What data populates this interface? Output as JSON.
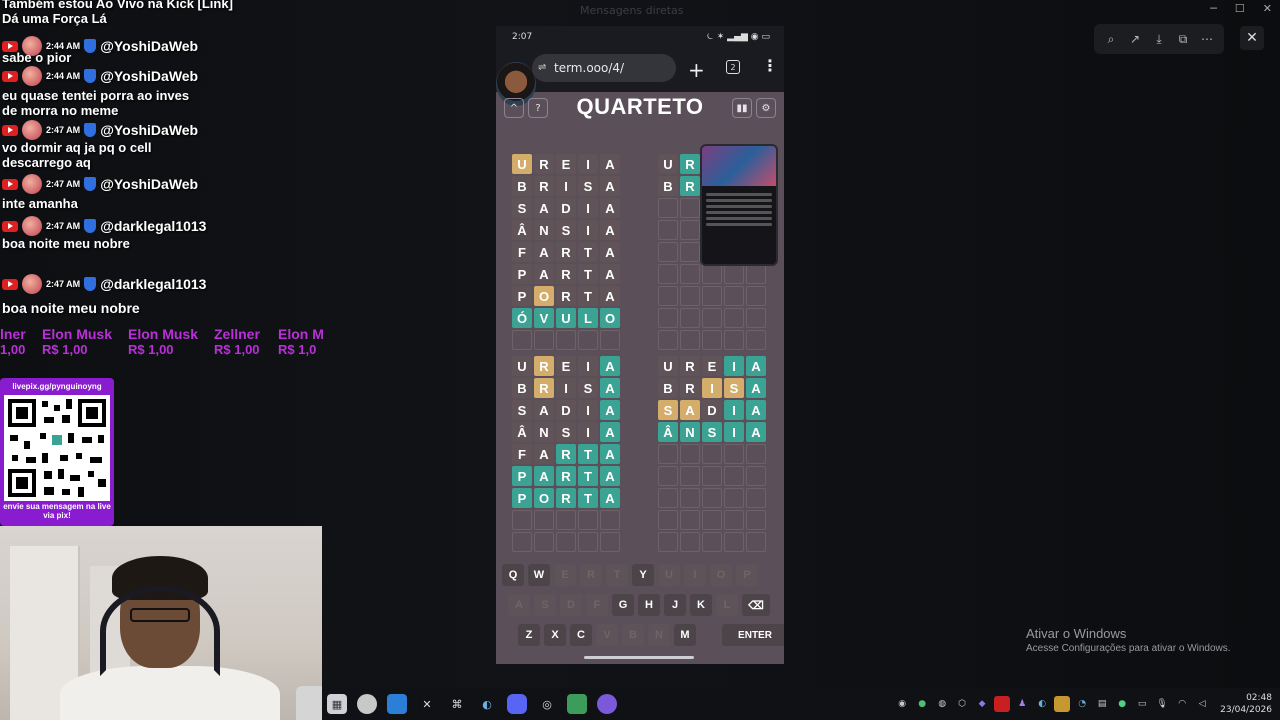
{
  "chat": {
    "messages": [
      {
        "user": "@YoshiDaWeb",
        "time": "2:44 AM",
        "text": "Também estou Ao Vivo na Kick [Link]",
        "text2": "Dá uma Força Lá"
      },
      {
        "user": "@YoshiDaWeb",
        "time": "2:44 AM",
        "text": "sabe o pior"
      },
      {
        "user": "@YoshiDaWeb",
        "time": "2:44 AM",
        "text": "o pior"
      },
      {
        "user": "@YoshiDaWeb",
        "time": "2:47 AM",
        "text": "eu quase tentei porra ao inves de morra no meme"
      },
      {
        "user": "@YoshiDaWeb",
        "time": "2:47 AM",
        "text": "vo dormir aq ja pq o cell descarrego aq"
      },
      {
        "user": "@YoshiDaWeb",
        "time": "2:47 AM",
        "text": "inte amanha"
      },
      {
        "user": "@darklegal1013",
        "time": "2:47 AM",
        "text": "boa noite meu nobre"
      }
    ]
  },
  "ticker": [
    {
      "name": "lner",
      "value": "1,00"
    },
    {
      "name": "Elon Musk",
      "value": "R$ 1,00"
    },
    {
      "name": "Elon Musk",
      "value": "R$ 1,00"
    },
    {
      "name": "Zellner",
      "value": "R$ 1,00"
    },
    {
      "name": "Elon M",
      "value": "R$ 1,0"
    }
  ],
  "pix": {
    "url": "livepix.gg/pynguinoyng",
    "cta": "envie sua mensagem na live via pix!"
  },
  "phone": {
    "time": "2:07",
    "url": "term.ooo/4/",
    "tabs_count": "2",
    "game_title": "QUARTETO",
    "help_icon": "?",
    "up_icon": "^",
    "boards": [
      {
        "rows": [
          [
            [
              "U",
              "y"
            ],
            [
              "R",
              "e"
            ],
            [
              "E",
              "e"
            ],
            [
              "I",
              "e"
            ],
            [
              "A",
              "e"
            ]
          ],
          [
            [
              "B",
              "e"
            ],
            [
              "R",
              "e"
            ],
            [
              "I",
              "e"
            ],
            [
              "S",
              "e"
            ],
            [
              "A",
              "e"
            ]
          ],
          [
            [
              "S",
              "e"
            ],
            [
              "A",
              "e"
            ],
            [
              "D",
              "e"
            ],
            [
              "I",
              "e"
            ],
            [
              "A",
              "e"
            ]
          ],
          [
            [
              "Â",
              "e"
            ],
            [
              "N",
              "e"
            ],
            [
              "S",
              "e"
            ],
            [
              "I",
              "e"
            ],
            [
              "A",
              "e"
            ]
          ],
          [
            [
              "F",
              "e"
            ],
            [
              "A",
              "e"
            ],
            [
              "R",
              "e"
            ],
            [
              "T",
              "e"
            ],
            [
              "A",
              "e"
            ]
          ],
          [
            [
              "P",
              "e"
            ],
            [
              "A",
              "e"
            ],
            [
              "R",
              "e"
            ],
            [
              "T",
              "e"
            ],
            [
              "A",
              "e"
            ]
          ],
          [
            [
              "P",
              "e"
            ],
            [
              "O",
              "y"
            ],
            [
              "R",
              "e"
            ],
            [
              "T",
              "e"
            ],
            [
              "A",
              "e"
            ]
          ],
          [
            [
              "Ó",
              "g"
            ],
            [
              "V",
              "g"
            ],
            [
              "U",
              "g"
            ],
            [
              "L",
              "g"
            ],
            [
              "O",
              "g"
            ]
          ]
        ]
      },
      {
        "rows": [
          [
            [
              "U",
              "e"
            ],
            [
              "R",
              "g"
            ],
            [
              "",
              ""
            ],
            [
              "",
              ""
            ],
            [
              "",
              ""
            ]
          ],
          [
            [
              "B",
              "e"
            ],
            [
              "R",
              "g"
            ],
            [
              "",
              ""
            ],
            [
              "",
              ""
            ],
            [
              "",
              ""
            ]
          ]
        ]
      },
      {
        "rows": [
          [
            [
              "U",
              "e"
            ],
            [
              "R",
              "y"
            ],
            [
              "E",
              "e"
            ],
            [
              "I",
              "e"
            ],
            [
              "A",
              "g"
            ]
          ],
          [
            [
              "B",
              "e"
            ],
            [
              "R",
              "y"
            ],
            [
              "I",
              "e"
            ],
            [
              "S",
              "e"
            ],
            [
              "A",
              "g"
            ]
          ],
          [
            [
              "S",
              "e"
            ],
            [
              "A",
              "e"
            ],
            [
              "D",
              "e"
            ],
            [
              "I",
              "e"
            ],
            [
              "A",
              "g"
            ]
          ],
          [
            [
              "Â",
              "e"
            ],
            [
              "N",
              "e"
            ],
            [
              "S",
              "e"
            ],
            [
              "I",
              "e"
            ],
            [
              "A",
              "g"
            ]
          ],
          [
            [
              "F",
              "e"
            ],
            [
              "A",
              "e"
            ],
            [
              "R",
              "g"
            ],
            [
              "T",
              "g"
            ],
            [
              "A",
              "g"
            ]
          ],
          [
            [
              "P",
              "g"
            ],
            [
              "A",
              "g"
            ],
            [
              "R",
              "g"
            ],
            [
              "T",
              "g"
            ],
            [
              "A",
              "g"
            ]
          ],
          [
            [
              "P",
              "g"
            ],
            [
              "O",
              "g"
            ],
            [
              "R",
              "g"
            ],
            [
              "T",
              "g"
            ],
            [
              "A",
              "g"
            ]
          ]
        ]
      },
      {
        "rows": [
          [
            [
              "U",
              "e"
            ],
            [
              "R",
              "e"
            ],
            [
              "E",
              "e"
            ],
            [
              "I",
              "g"
            ],
            [
              "A",
              "g"
            ]
          ],
          [
            [
              "B",
              "e"
            ],
            [
              "R",
              "e"
            ],
            [
              "I",
              "y"
            ],
            [
              "S",
              "y"
            ],
            [
              "A",
              "g"
            ]
          ],
          [
            [
              "S",
              "y"
            ],
            [
              "A",
              "y"
            ],
            [
              "D",
              "e"
            ],
            [
              "I",
              "g"
            ],
            [
              "A",
              "g"
            ]
          ],
          [
            [
              "Â",
              "g"
            ],
            [
              "N",
              "g"
            ],
            [
              "S",
              "g"
            ],
            [
              "I",
              "g"
            ],
            [
              "A",
              "g"
            ]
          ]
        ]
      }
    ],
    "keyboard": {
      "row1": [
        [
          "Q",
          1
        ],
        [
          "W",
          1
        ],
        [
          "E",
          0
        ],
        [
          "R",
          0
        ],
        [
          "T",
          0
        ],
        [
          "Y",
          1
        ],
        [
          "U",
          0
        ],
        [
          "I",
          0
        ],
        [
          "O",
          0
        ],
        [
          "P",
          0
        ]
      ],
      "row2": [
        [
          "A",
          0
        ],
        [
          "S",
          0
        ],
        [
          "D",
          0
        ],
        [
          "F",
          0
        ],
        [
          "G",
          1
        ],
        [
          "H",
          1
        ],
        [
          "J",
          1
        ],
        [
          "K",
          1
        ],
        [
          "L",
          0
        ]
      ],
      "row3": [
        [
          "Z",
          1
        ],
        [
          "X",
          1
        ],
        [
          "C",
          1
        ],
        [
          "V",
          0
        ],
        [
          "B",
          0
        ],
        [
          "N",
          0
        ],
        [
          "M",
          1
        ]
      ],
      "enter": "ENTER",
      "backspace": "⌫"
    }
  },
  "windows": {
    "activate_title": "Ativar o Windows",
    "activate_sub": "Acesse Configurações para ativar o Windows."
  },
  "taskbar": {
    "time": "02:48",
    "date": "23/04/2026"
  },
  "bg": {
    "title": "Mensagens diretas"
  }
}
